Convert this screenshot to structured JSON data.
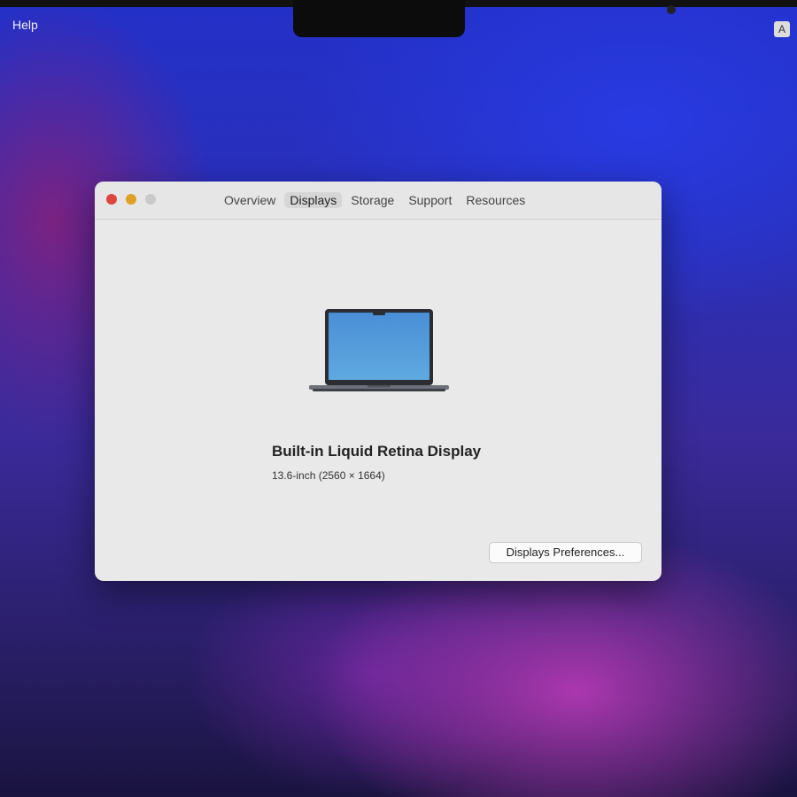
{
  "menubar": {
    "help_label": "Help",
    "input_indicator": "A"
  },
  "window": {
    "traffic_lights": [
      "close-icon",
      "minimize-icon",
      "zoom-icon"
    ],
    "tabs": [
      {
        "label": "Overview",
        "active": false
      },
      {
        "label": "Displays",
        "active": true
      },
      {
        "label": "Storage",
        "active": false
      },
      {
        "label": "Support",
        "active": false
      },
      {
        "label": "Resources",
        "active": false
      }
    ],
    "display": {
      "icon": "laptop-icon",
      "name": "Built-in Liquid Retina Display",
      "spec": "13.6-inch (2560 × 1664)"
    },
    "preferences_button": "Displays Preferences..."
  }
}
